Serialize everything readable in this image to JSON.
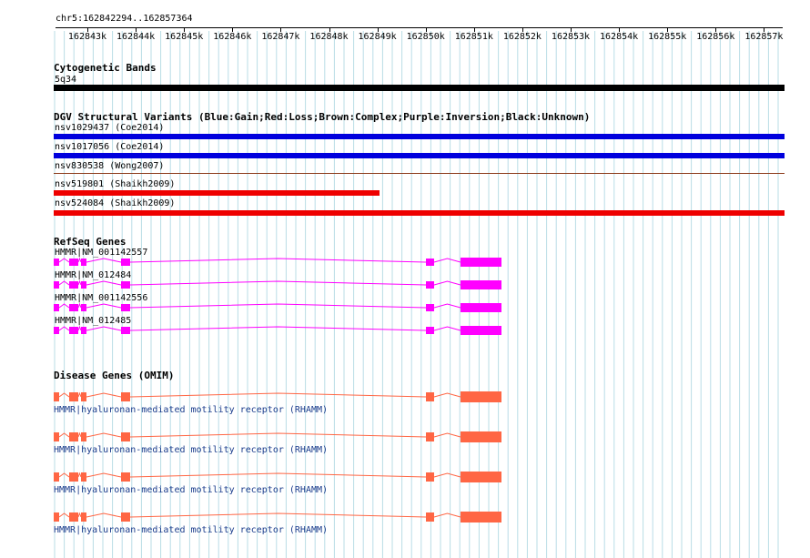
{
  "location": "chr5:162842294..162857364",
  "ruler": {
    "ticks": [
      "162843k",
      "162844k",
      "162845k",
      "162846k",
      "162847k",
      "162848k",
      "162849k",
      "162850k",
      "162851k",
      "162852k",
      "162853k",
      "162854k",
      "162855k",
      "162856k",
      "162857k"
    ]
  },
  "cytobands": {
    "title": "Cytogenetic Bands",
    "band_label": "5q34",
    "band_color": "#000000"
  },
  "dgv": {
    "title": "DGV Structural Variants (Blue:Gain;Red:Loss;Brown:Complex;Purple:Inversion;Black:Unknown)",
    "variants": [
      {
        "label": "nsv1029437 (Coe2014)",
        "color": "#0000dd",
        "type": "gain"
      },
      {
        "label": "nsv1017056 (Coe2014)",
        "color": "#0000dd",
        "type": "gain"
      },
      {
        "label": "nsv830538 (Wong2007)",
        "color": "#8b3a1a",
        "type": "complex"
      },
      {
        "label": "nsv519801 (Shaikh2009)",
        "color": "#ee0000",
        "type": "loss"
      },
      {
        "label": "nsv524084 (Shaikh2009)",
        "color": "#ee0000",
        "type": "loss"
      }
    ]
  },
  "refseq": {
    "title": "RefSeq Genes",
    "color": "#ff00ff",
    "transcripts": [
      {
        "label": "HMMR|NM_001142557"
      },
      {
        "label": "HMMR|NM_012484"
      },
      {
        "label": "HMMR|NM_001142556"
      },
      {
        "label": "HMMR|NM_012485"
      }
    ]
  },
  "omim": {
    "title": "Disease Genes (OMIM)",
    "color": "#ff6644",
    "entries": [
      {
        "label": "HMMR|hyaluronan-mediated motility receptor (RHAMM)"
      },
      {
        "label": "HMMR|hyaluronan-mediated motility receptor (RHAMM)"
      },
      {
        "label": "HMMR|hyaluronan-mediated motility receptor (RHAMM)"
      },
      {
        "label": "HMMR|hyaluronan-mediated motility receptor (RHAMM)"
      }
    ]
  }
}
